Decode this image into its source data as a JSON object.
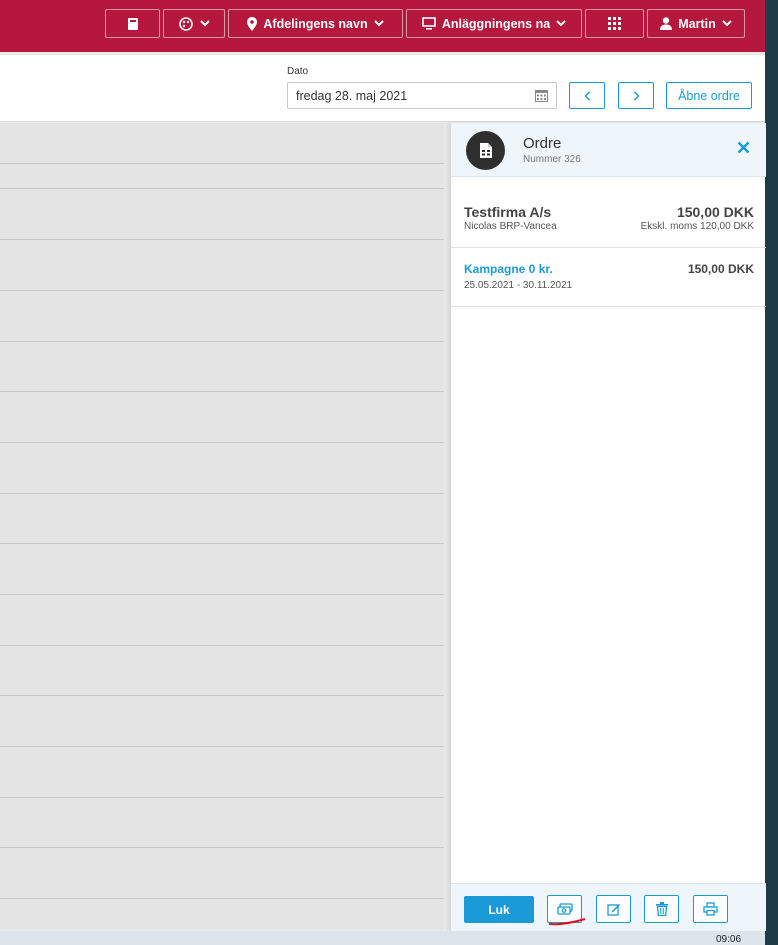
{
  "topbar": {
    "department_label": "Afdelingens navn",
    "facility_label": "Anläggningens na",
    "user_label": "Martin"
  },
  "toolbar": {
    "date_label": "Dato",
    "date_value": "fredag 28. maj 2021",
    "prev_label": "<",
    "next_label": ">",
    "open_orders_label": "Åbne ordre"
  },
  "order": {
    "title": "Ordre",
    "number": "Nummer 326",
    "customer": {
      "name": "Testfirma A/s",
      "contact": "Nicolas BRP-Vancea",
      "amount": "150,00 DKK",
      "excl_vat": "Ekskl. moms 120,00 DKK"
    },
    "line": {
      "name": "Kampagne 0 kr.",
      "period": "25.05.2021 - 30.11.2021",
      "amount": "150,00 DKK"
    },
    "footer": {
      "close_label": "Luk"
    }
  },
  "taskbar": {
    "clock": "09:06"
  },
  "colors": {
    "brand": "#b5173d",
    "accent": "#1a9bd7",
    "annotation": "#e0101a"
  }
}
